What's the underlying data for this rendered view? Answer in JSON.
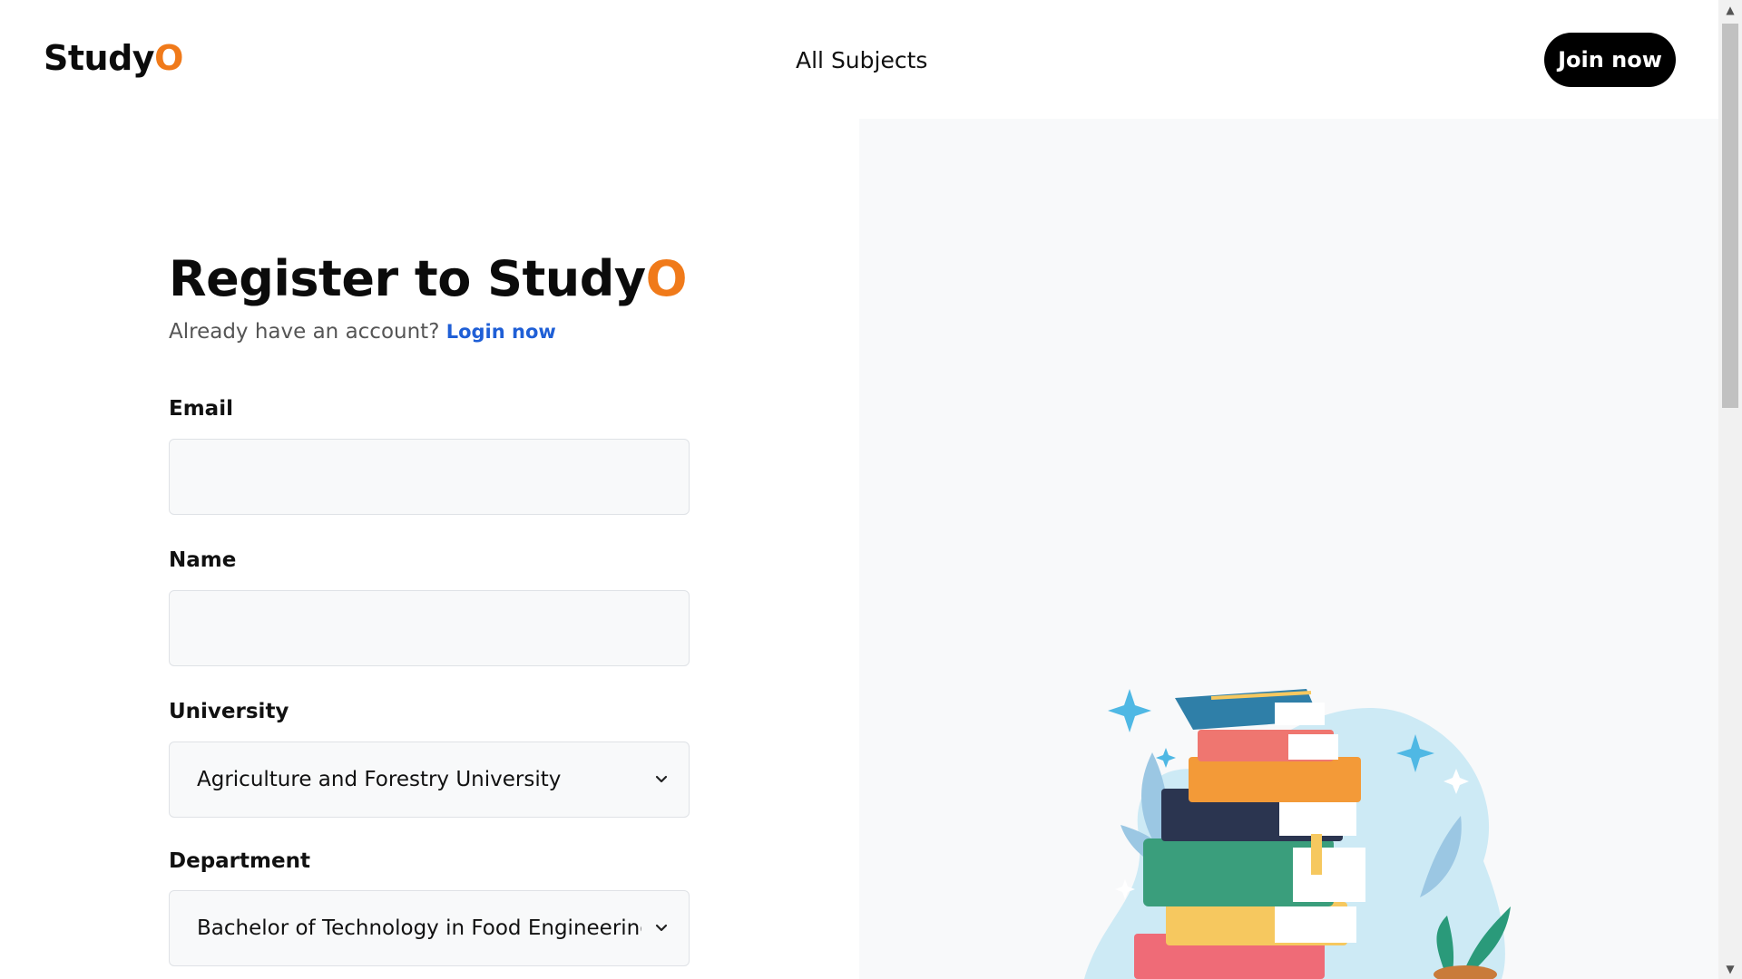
{
  "header": {
    "logo_main": "Study",
    "logo_accent": "O",
    "nav_link": "All Subjects",
    "join_button": "Join now"
  },
  "form": {
    "title_main": "Register to Study",
    "title_accent": "O",
    "subtitle_text": "Already have an account?",
    "login_link": "Login now",
    "email_label": "Email",
    "email_value": "",
    "name_label": "Name",
    "name_value": "",
    "university_label": "University",
    "university_selected": "Agriculture and Forestry University",
    "department_label": "Department",
    "department_selected": "Bachelor of Technology in Food Engineering ar"
  },
  "colors": {
    "accent": "#f07a1a",
    "link": "#1f5fd6",
    "button_bg": "#000000",
    "panel_bg": "#f8f9fa"
  },
  "icons": [
    "chevron-down-icon",
    "books-illustration",
    "sparkle-icon",
    "plant-icon"
  ]
}
